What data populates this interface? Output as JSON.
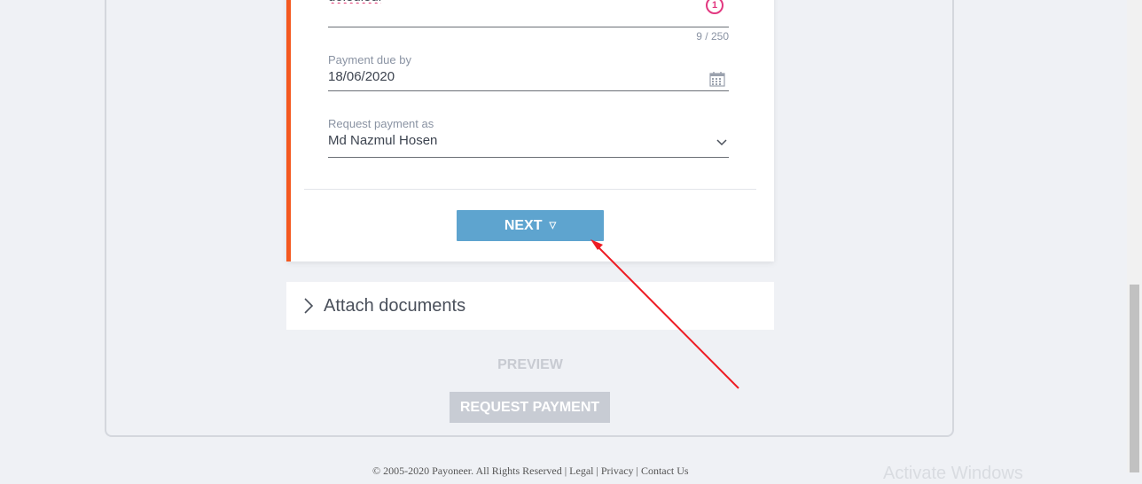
{
  "description_field": {
    "value": "doledledl",
    "badge": "1",
    "counter": "9 / 250"
  },
  "due_date_field": {
    "label": "Payment due by",
    "value": "18/06/2020"
  },
  "request_as_field": {
    "label": "Request payment as",
    "value": "Md Nazmul Hosen"
  },
  "next_button": {
    "label": "NEXT",
    "glyph": "▽"
  },
  "attach": {
    "label": "Attach documents"
  },
  "preview": {
    "label": "PREVIEW"
  },
  "request_button": {
    "label": "REQUEST PAYMENT"
  },
  "footer": {
    "text": "© 2005-2020 Payoneer. All Rights Reserved | Legal | Privacy | Contact Us"
  },
  "watermark": {
    "text": "Activate Windows"
  },
  "colors": {
    "accent": "#f4581f",
    "primary_button": "#5ea4cf",
    "disabled_button": "#c8ccd4",
    "error_badge": "#e23880",
    "annotation_arrow": "#ee1c24"
  }
}
